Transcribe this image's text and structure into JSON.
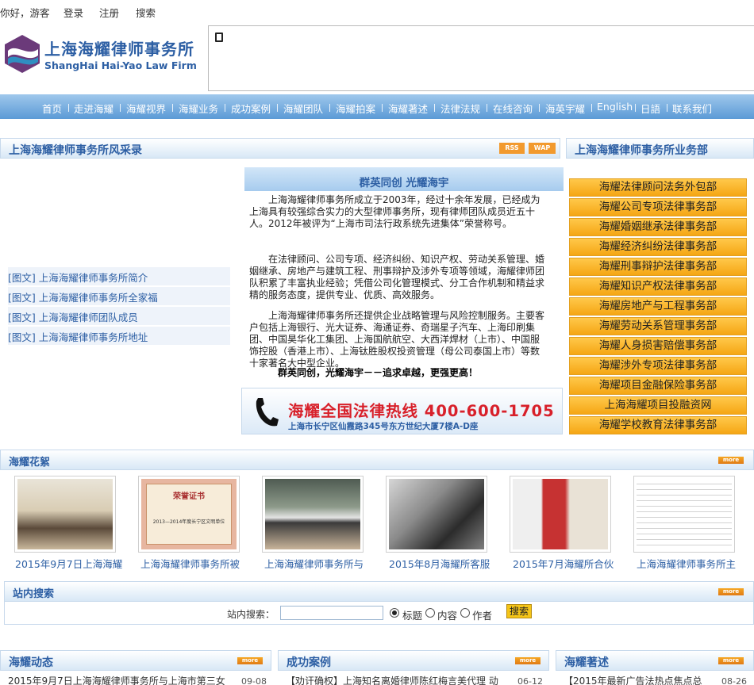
{
  "topbar": {
    "greeting": "你好，游客",
    "login": "登录",
    "register": "注册",
    "search": "搜索"
  },
  "logo": {
    "cn": "上海海耀律师事务所",
    "en": "ShangHai Hai-Yao Law Firm"
  },
  "nav": [
    "首页",
    "走进海耀",
    "海耀视界",
    "海耀业务",
    "成功案例",
    "海耀团队",
    "海耀拍案",
    "海耀著述",
    "法律法规",
    "在线咨询",
    "海英宇耀",
    "English",
    "日語",
    "联系我们"
  ],
  "left_section": {
    "title": "上海海耀律师事务所风采录",
    "rss": "RSS",
    "wap": "WAP",
    "items": [
      "[图文] 上海海耀律师事务所简介",
      "[图文] 上海海耀律师事务所全家福",
      "[图文] 上海海耀律师团队成员",
      "[图文] 上海海耀律师事务所地址"
    ]
  },
  "intro": {
    "heading": "群英同创  光耀海宇",
    "p1": "　　上海海耀律师事务所成立于2003年，经过十余年发展，已经成为上海具有较强综合实力的大型律师事务所，现有律师团队成员近五十人。2012年被评为“上海市司法行政系统先进集体”荣誉称号。",
    "p2": "　　在法律顾问、公司专项、经济纠纷、知识产权、劳动关系管理、婚姻继承、房地产与建筑工程、刑事辩护及涉外专项等领域，海耀律师团队积累了丰富执业经验；凭借公司化管理模式、分工合作机制和精益求精的服务态度，提供专业、优质、高效服务。",
    "p3": "　　上海海耀律师事务所还提供企业战略管理与风险控制服务。主要客户包括上海银行、光大证券、海通证券、奇瑞星子汽车、上海印刷集团、中国昊华化工集团、上海国航航空、大西洋焊材（上市）、中国服饰控股（香港上市）、上海钛胜股权投资管理（母公司泰国上市）等数十家著名大中型企业。",
    "slogan": "群英同创，光耀海宇－－追求卓越，更强更高！"
  },
  "hotline": {
    "big": "海耀全国法律热线 400-600-1705",
    "small": "上海市长宁区仙霞路345号东方世纪大厦7楼A-D座"
  },
  "right_section": {
    "title": "上海海耀律师事务所业务部",
    "items": [
      "海耀法律顾问法务外包部",
      "海耀公司专项法律事务部",
      "海耀婚姻继承法律事务部",
      "海耀经济纠纷法律事务部",
      "海耀刑事辩护法律事务部",
      "海耀知识产权法律事务部",
      "海耀房地产与工程事务部",
      "海耀劳动关系管理事务部",
      "海耀人身损害赔偿事务部",
      "海耀涉外专项法律事务部",
      "海耀项目金融保险事务部",
      "上海海耀项目投融资网",
      "海耀学校教育法律事务部"
    ]
  },
  "gallery": {
    "title": "海耀花絮",
    "more": "more",
    "captions": [
      "2015年9月7日上海海耀",
      "上海海耀律师事务所被",
      "上海海耀律师事务所与",
      "2015年8月海耀所客服",
      "2015年7月海耀所合伙",
      "上海海耀律师事务所主"
    ],
    "cert_title": "荣誉证书",
    "cert_line": "2013—2014年度长宁区文明单位"
  },
  "search": {
    "title": "站内搜索",
    "more": "more",
    "label": "站内搜索：",
    "opt1": "标题",
    "opt2": "内容",
    "opt3": "作者",
    "button": "搜索"
  },
  "bottom": {
    "col1": {
      "title": "海耀动态",
      "more": "more",
      "item": "2015年9月7日上海海耀律师事务所与上海市第三女",
      "date": "09-08"
    },
    "col2": {
      "title": "成功案例",
      "more": "more",
      "item": "【劝讦确权】上海知名离婚律师陈红梅言美代理 动",
      "date": "06-12"
    },
    "col3": {
      "title": "海耀著述",
      "more": "more",
      "item": "【2015年最新广告法热点焦点总",
      "date": "08-26"
    }
  },
  "colors": {
    "brand": "#2d5fa4",
    "nav": "#5b9ad6",
    "dept": "#f5a614",
    "hotline_red": "#d8202a"
  }
}
